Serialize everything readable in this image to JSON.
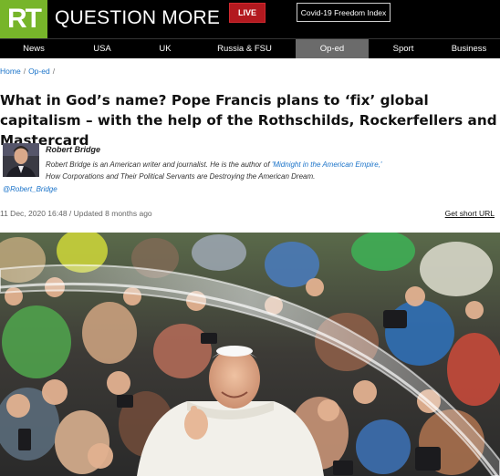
{
  "header": {
    "logo_text": "RT",
    "tagline": "QUESTION MORE",
    "live_label": "LIVE",
    "covid_label": "Covid-19 Freedom Index",
    "colors": {
      "logo_green": "#77b52a",
      "live_red": "#b3191f",
      "bar": "#000000"
    }
  },
  "nav": {
    "items": [
      {
        "label": "News"
      },
      {
        "label": "USA"
      },
      {
        "label": "UK"
      },
      {
        "label": "Russia & FSU"
      },
      {
        "label": "Op-ed",
        "active": true
      },
      {
        "label": "Sport"
      },
      {
        "label": "Business"
      }
    ]
  },
  "breadcrumb": {
    "home": "Home",
    "section": "Op-ed"
  },
  "article": {
    "title": "What in God’s name? Pope Francis plans to ‘fix’ global capitalism – with the help of the Rothschilds, Rockerfellers and Mastercard",
    "author": {
      "name": "Robert Bridge",
      "bio_before": "Robert Bridge is an American writer and journalist. He is the author of ",
      "bio_link": "'Midnight in the American Empire,'",
      "bio_after": " How Corporations and Their Political Servants are Destroying the American Dream.",
      "handle": "@Robert_Bridge"
    },
    "dateline": "11 Dec, 2020 16:48 / Updated 8 months ago",
    "short_url_label": "Get short URL"
  },
  "photo": {
    "icon": "pope-crowd-photo"
  }
}
